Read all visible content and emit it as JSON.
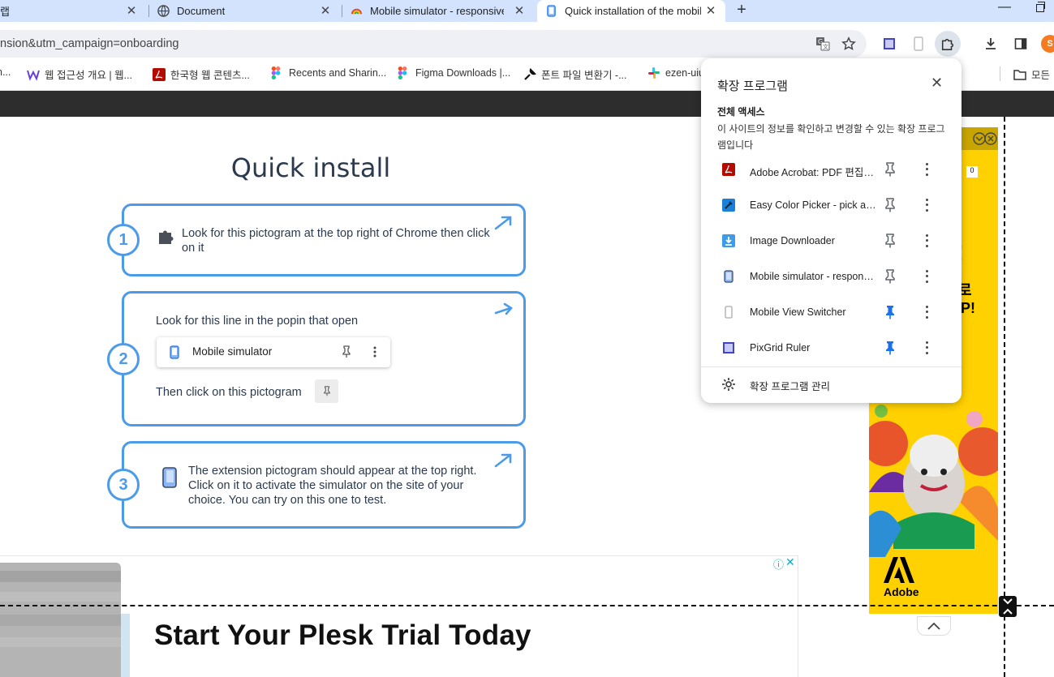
{
  "tabs": [
    {
      "title": "랩",
      "active": false
    },
    {
      "title": "Document",
      "active": false
    },
    {
      "title": "Mobile simulator - responsive",
      "active": false
    },
    {
      "title": "Quick installation of the mobil",
      "active": true
    }
  ],
  "tab_close_glyph": "✕",
  "new_tab_glyph": "+",
  "omnibox": {
    "url": "nsion&utm_campaign=onboarding"
  },
  "profile": {
    "initial": "S"
  },
  "bookmarks": [
    {
      "label": "n..."
    },
    {
      "label": "웹 접근성 개요 | 웹..."
    },
    {
      "label": "한국형 웹 콘텐츠..."
    },
    {
      "label": "Recents and Sharin..."
    },
    {
      "label": "Figma Downloads |..."
    },
    {
      "label": "폰트 파일 변환기 -..."
    },
    {
      "label": "ezen-uiu"
    },
    {
      "label": "모든"
    }
  ],
  "page": {
    "title": "Quick install",
    "steps": [
      {
        "number": "1",
        "text": "Look for this pictogram at the top right of Chrome then click on it"
      },
      {
        "number": "2",
        "text_top": "Look for this line in the popin that open",
        "popup_label": "Mobile simulator",
        "text_bottom": "Then click on this pictogram"
      },
      {
        "number": "3",
        "text": "The extension pictogram should appear at the top right. Click on it to activate the simulator on the site of your choice. You can try on this one to test."
      }
    ]
  },
  "bottom_ad": {
    "headline": "Start Your Plesk Trial Today",
    "info_glyph": "ⓘ",
    "close_glyph": "✕"
  },
  "right_ad": {
    "brand": "Adobe",
    "counter": "0",
    "line1": "!",
    "line2": "로",
    "line3": "UP!",
    "bg_color": "#ffd100"
  },
  "extensions_popup": {
    "title": "확장 프로그램",
    "close_glyph": "✕",
    "access_heading": "전체 액세스",
    "access_description": "이 사이트의 정보를 확인하고 변경할 수 있는 확장 프로그램입니다",
    "items": [
      {
        "name": "Adobe Acrobat: PDF 편집, 변환, 서명 도구",
        "icon": "adobe-acrobat-icon",
        "pinned": false
      },
      {
        "name": "Easy Color Picker - pick a color",
        "icon": "color-picker-icon",
        "pinned": false
      },
      {
        "name": "Image Downloader",
        "icon": "image-downloader-icon",
        "pinned": false
      },
      {
        "name": "Mobile simulator - responsive testing tool",
        "icon": "mobile-simulator-icon",
        "pinned": false
      },
      {
        "name": "Mobile View Switcher",
        "icon": "mobile-view-switcher-icon",
        "pinned": true
      },
      {
        "name": "PixGrid Ruler",
        "icon": "pixgrid-ruler-icon",
        "pinned": true
      }
    ],
    "manage_label": "확장 프로그램 관리",
    "pin_color_active": "#1a73e8",
    "pin_color_inactive": "#5f6368"
  },
  "colors": {
    "accent": "#4b9be8",
    "tabstrip": "#d3e3fd",
    "heading": "#2b3a4e"
  }
}
